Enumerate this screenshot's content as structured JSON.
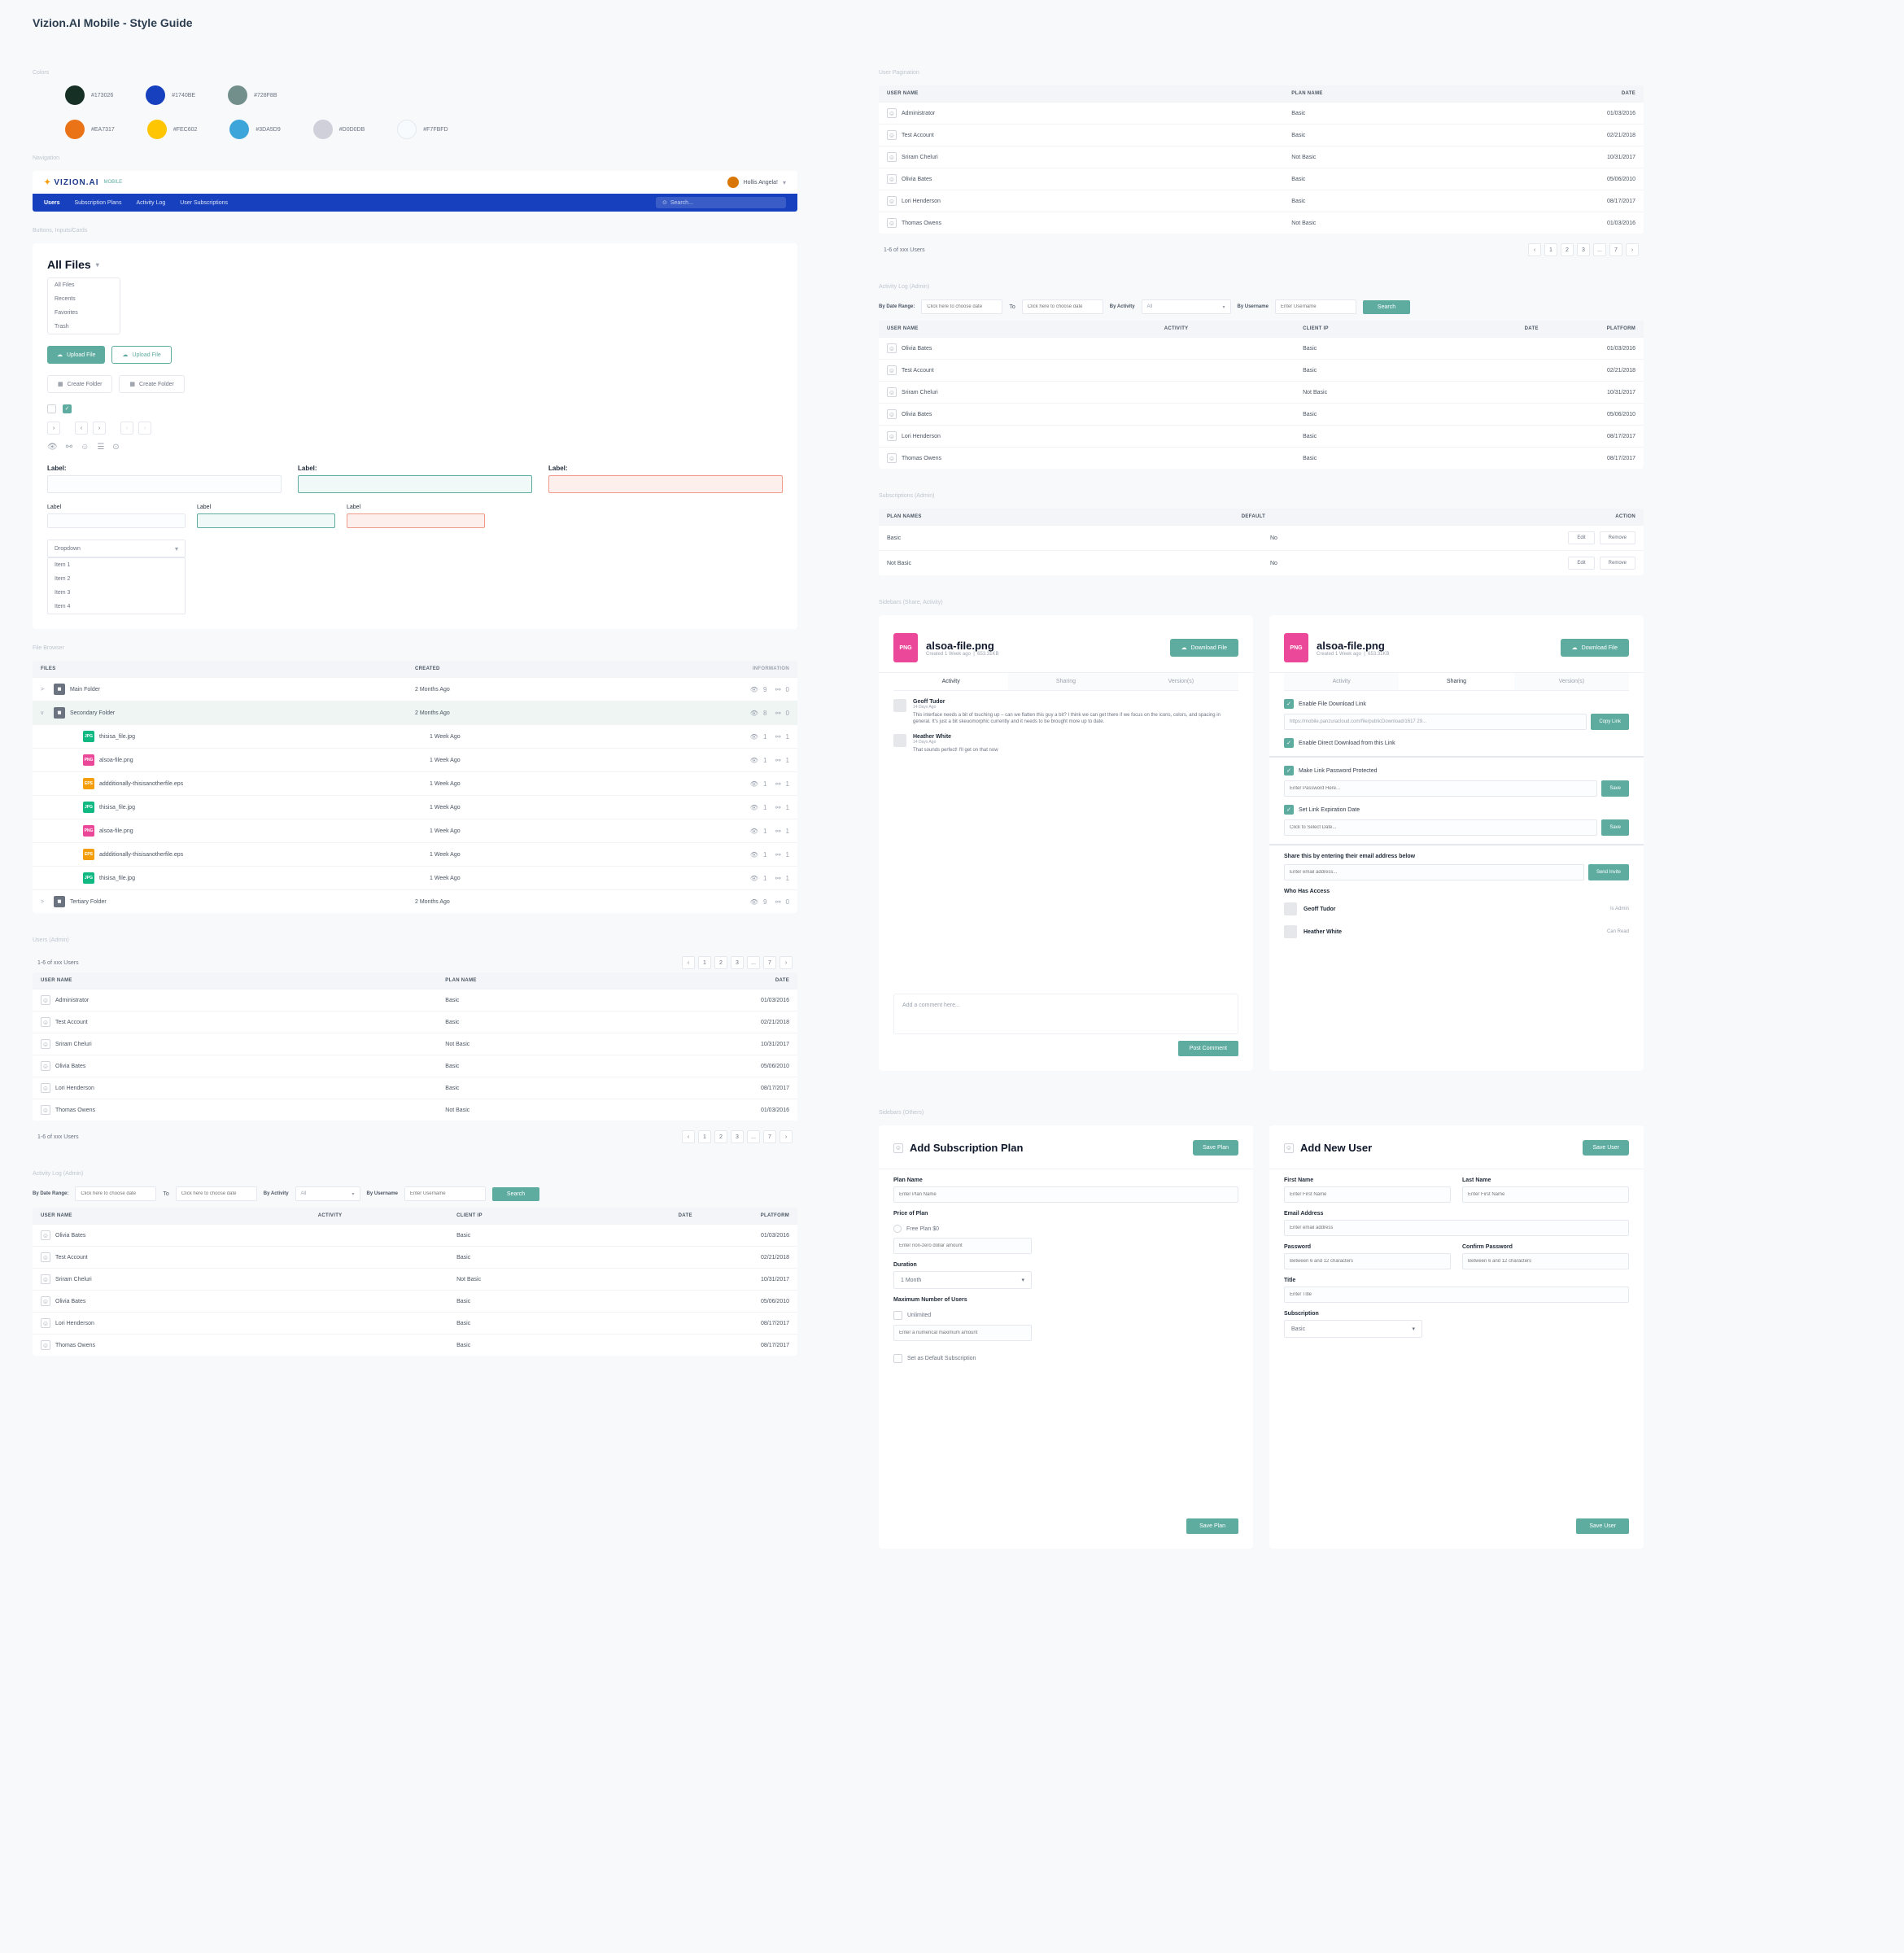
{
  "title": "Vizion.AI Mobile - Style Guide",
  "sections": {
    "colors": "Colors",
    "navigation": "Navigation",
    "buttons": "Buttons, Inputs/Cards",
    "file_browser": "File Browser",
    "users_admin": "Users (Admin)",
    "activity": "Activity Log (Admin)",
    "user_pagination": "User Pagination",
    "activity_admin": "Activity Log (Admin)",
    "subscriptions": "Subscriptions (Admin)",
    "sidebars1": "Sidebars (Share, Activity)",
    "sidebars2": "Sidebars (Others)"
  },
  "colors": {
    "row1": [
      {
        "hex": "#173026"
      },
      {
        "hex": "#1740BE"
      },
      {
        "hex": "#728F8B"
      }
    ],
    "row2": [
      {
        "hex": "#EA7317"
      },
      {
        "hex": "#FEC602"
      },
      {
        "hex": "#3DA5D9"
      },
      {
        "hex": "#D0D0DB"
      },
      {
        "hex": "#F7FBFD"
      }
    ]
  },
  "nav": {
    "logo": "VIZION.AI",
    "mobile": "MOBILE",
    "user": "Hollis Angela!",
    "items": [
      "Users",
      "Subscription Plans",
      "Activity Log",
      "User Subscriptions"
    ],
    "search_ph": "Search..."
  },
  "all_files": {
    "title": "All Files",
    "menu": [
      "All Files",
      "Recents",
      "Favorites",
      "Trash"
    ]
  },
  "buttons": {
    "upload_file": "Upload File",
    "upload_file2": "Upload File",
    "create_folder": "Create Folder",
    "create_folder2": "Create Folder"
  },
  "inputs": {
    "label": "Label:"
  },
  "dropdown": {
    "label": "Dropdown",
    "items": [
      "Item 1",
      "Item 2",
      "Item 3",
      "Item 4"
    ]
  },
  "file_table": {
    "headers": {
      "files": "FILES",
      "created": "CREATED",
      "info": "INFORMATION"
    },
    "rows": [
      {
        "icon": "folder",
        "name": "Main Folder",
        "created": "2 Months Ago",
        "info": {
          "views": 9,
          "shares": 0
        },
        "expand": ">"
      },
      {
        "icon": "folder",
        "name": "Secondary Folder",
        "created": "2 Months Ago",
        "info": {
          "views": 8,
          "shares": 0
        },
        "expand": "v",
        "sel": true
      },
      {
        "icon": "jpg",
        "name": "thisisa_file.jpg",
        "created": "1 Week Ago",
        "info": {
          "views": 1,
          "shares": 1
        },
        "indent": true
      },
      {
        "icon": "png",
        "name": "alsoa-file.png",
        "created": "1 Week Ago",
        "info": {
          "views": 1,
          "shares": 1
        },
        "indent": true
      },
      {
        "icon": "eps",
        "name": "addditionally-thisisanotherfile.eps",
        "created": "1 Week Ago",
        "info": {
          "views": 1,
          "shares": 1
        },
        "indent": true
      },
      {
        "icon": "jpg",
        "name": "thisisa_file.jpg",
        "created": "1 Week Ago",
        "info": {
          "views": 1,
          "shares": 1
        },
        "indent": true
      },
      {
        "icon": "png",
        "name": "alsoa-file.png",
        "created": "1 Week Ago",
        "info": {
          "views": 1,
          "shares": 1
        },
        "indent": true
      },
      {
        "icon": "eps",
        "name": "addditionally-thisisanotherfile.eps",
        "created": "1 Week Ago",
        "info": {
          "views": 1,
          "shares": 1
        },
        "indent": true
      },
      {
        "icon": "jpg",
        "name": "thisisa_file.jpg",
        "created": "1 Week Ago",
        "info": {
          "views": 1,
          "shares": 1
        },
        "indent": true
      },
      {
        "icon": "folder",
        "name": "Tertiary Folder",
        "created": "2 Months Ago",
        "info": {
          "views": 9,
          "shares": 0
        },
        "expand": ">"
      }
    ]
  },
  "users": {
    "count": "1-6 of xxx Users",
    "headers": {
      "name": "USER NAME",
      "plan": "PLAN NAME",
      "date": "DATE"
    },
    "rows": [
      {
        "name": "Administrator",
        "plan": "Basic",
        "date": "01/03/2016"
      },
      {
        "name": "Test Account",
        "plan": "Basic",
        "date": "02/21/2018"
      },
      {
        "name": "Sriram Cheluri",
        "plan": "Not Basic",
        "date": "10/31/2017"
      },
      {
        "name": "Olivia Bates",
        "plan": "Basic",
        "date": "05/06/2010"
      },
      {
        "name": "Lori Henderson",
        "plan": "Basic",
        "date": "08/17/2017"
      },
      {
        "name": "Thomas Owens",
        "plan": "Not Basic",
        "date": "01/03/2016"
      }
    ],
    "pages": [
      "1",
      "2",
      "3",
      "...",
      "7"
    ]
  },
  "activity": {
    "filters": {
      "daterange": "By Date Range:",
      "to": "To",
      "by_activity": "By Activity",
      "all": "All",
      "by_username": "By Username",
      "user_ph": "Enter Username",
      "date_ph": "Click here to choose date",
      "search": "Search"
    },
    "headers": {
      "name": "USER NAME",
      "activity": "ACTIVITY",
      "ip": "CLIENT IP",
      "date": "DATE",
      "platform": "PLATFORM"
    },
    "rows": [
      {
        "name": "Olivia Bates",
        "ip": "Basic",
        "date": "01/03/2016"
      },
      {
        "name": "Test Account",
        "ip": "Basic",
        "date": "02/21/2018"
      },
      {
        "name": "Sriram Cheluri",
        "ip": "Not Basic",
        "date": "10/31/2017"
      },
      {
        "name": "Olivia Bates",
        "ip": "Basic",
        "date": "05/06/2010"
      },
      {
        "name": "Lori Henderson",
        "ip": "Basic",
        "date": "08/17/2017"
      },
      {
        "name": "Thomas Owens",
        "ip": "Basic",
        "date": "08/17/2017"
      }
    ]
  },
  "subs": {
    "headers": {
      "plan": "PLAN NAMES",
      "default": "DEFAULT",
      "action": "ACTION"
    },
    "rows": [
      {
        "name": "Basic",
        "default": "No"
      },
      {
        "name": "Not Basic",
        "default": "No"
      }
    ],
    "edit": "Edit",
    "remove": "Remove"
  },
  "detail": {
    "file": "alsoa-file.png",
    "meta_created": "Created 1 Week ago",
    "meta_size": "653.31KB",
    "download": "Download File",
    "tabs": [
      "Activity",
      "Sharing",
      "Version(s)"
    ],
    "comments": [
      {
        "name": "Geoff Tudor",
        "time": "14 Days Ago",
        "text": "This interface needs a bit of touching up – can we flatten this guy a bit? I think we can get there if we focus on the icons, colors, and spacing in general. It's just a bit skeuomorphic currently and it needs to be brought more up to date."
      },
      {
        "name": "Heather White",
        "time": "14 Days Ago",
        "text": "That sounds perfect! I'll get on that now"
      }
    ],
    "add_comment_ph": "Add a comment here...",
    "post": "Post Comment"
  },
  "sharing": {
    "enable_dl": "Enable File Download Link",
    "link": "https://mobile.panzuracloud.com/file/publicDownload/1617 29...",
    "copy": "Copy Link",
    "enable_direct": "Enable Direct Download from this Link",
    "pw_protect": "Make Link Password Protected",
    "pw_ph": "Enter Password Here...",
    "save": "Save",
    "set_exp": "Set Link Expiration Date",
    "date_ph": "Click to Select Date...",
    "share_email": "Share this by entering their email address below",
    "email_ph": "Enter email address...",
    "send": "Send Invite",
    "who_access": "Who Has Access",
    "access": [
      {
        "name": "Geoff Tudor",
        "role": "Is Admin"
      },
      {
        "name": "Heather White",
        "role": "Can Read"
      }
    ]
  },
  "add_plan": {
    "title": "Add Subscription Plan",
    "save": "Save Plan",
    "plan_name": "Plan Name",
    "plan_name_ph": "Enter Plan Name",
    "price": "Price of Plan",
    "free": "Free Plan $0",
    "price_ph": "Enter non-zero dollar amount",
    "duration": "Duration",
    "duration_val": "1 Month",
    "max_users": "Maximum Number of Users",
    "unlimited": "Unlimited",
    "max_ph": "Enter a numerical maximum amount",
    "default": "Set as Default Subscription"
  },
  "add_user": {
    "title": "Add New User",
    "save": "Save User",
    "first": "First Name",
    "first_ph": "Enter First Name",
    "last": "Last Name",
    "last_ph": "Enter First Name",
    "email": "Email Address",
    "email_ph": "Enter email address",
    "password": "Password",
    "pw_ph": "Between 6 and 12 characters",
    "confirm": "Confirm Password",
    "title_label": "Title",
    "title_ph": "Enter Title",
    "sub": "Subscription",
    "sub_val": "Basic"
  }
}
